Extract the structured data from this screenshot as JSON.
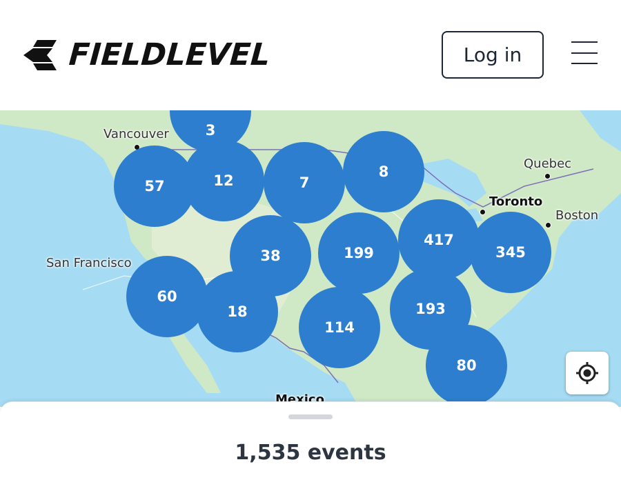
{
  "header": {
    "brand": "FIELDLEVEL",
    "login_label": "Log in",
    "menu_icon": "hamburger-menu-icon"
  },
  "map": {
    "cities": [
      {
        "name": "Vancouver",
        "bold": false
      },
      {
        "name": "Quebec",
        "bold": false
      },
      {
        "name": "Toronto",
        "bold": true
      },
      {
        "name": "Boston",
        "bold": false
      },
      {
        "name": "San Francisco",
        "bold": false
      },
      {
        "name": "Mexico",
        "bold": true
      }
    ],
    "clusters": [
      {
        "count": "3"
      },
      {
        "count": "57"
      },
      {
        "count": "12"
      },
      {
        "count": "7"
      },
      {
        "count": "8"
      },
      {
        "count": "38"
      },
      {
        "count": "199"
      },
      {
        "count": "417"
      },
      {
        "count": "345"
      },
      {
        "count": "60"
      },
      {
        "count": "18"
      },
      {
        "count": "114"
      },
      {
        "count": "193"
      },
      {
        "count": "80"
      }
    ],
    "cluster_color": "#2e7ecf",
    "water_color": "#a6dcf3",
    "land_color": "#cfe9c6",
    "locate_icon": "crosshair-location-icon"
  },
  "sheet": {
    "event_count": "1,535 events"
  }
}
